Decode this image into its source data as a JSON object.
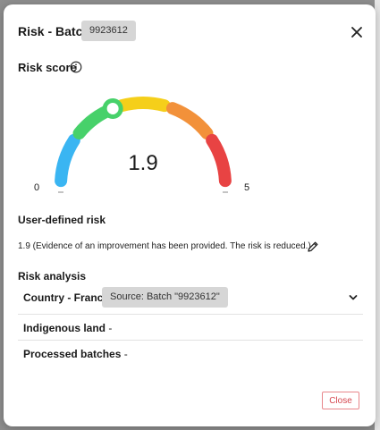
{
  "modal": {
    "title": "Risk - Batch",
    "batch_chip": "9923612"
  },
  "risk_score": {
    "label": "Risk score",
    "value": 1.9,
    "value_text": "1.9",
    "min": "0",
    "max": "5",
    "segments": [
      {
        "color": "#3ab5f2"
      },
      {
        "color": "#47d16a"
      },
      {
        "color": "#f5cf1a"
      },
      {
        "color": "#f2913a"
      },
      {
        "color": "#e84343"
      }
    ]
  },
  "user_defined_risk": {
    "label": "User-defined risk",
    "text": "1.9 (Evidence of an improvement has been provided. The risk is reduced.)"
  },
  "risk_analysis": {
    "label": "Risk analysis",
    "rows": [
      {
        "title": "Country - France",
        "source": "Source: Batch \"9923612\""
      },
      {
        "title": "Indigenous land",
        "suffix": " -"
      },
      {
        "title": "Processed batches",
        "suffix": " -"
      }
    ]
  },
  "footer": {
    "close_label": "Close"
  },
  "colors": {
    "accent_red": "#d5454e",
    "chip_bg": "#d6d6d6"
  }
}
